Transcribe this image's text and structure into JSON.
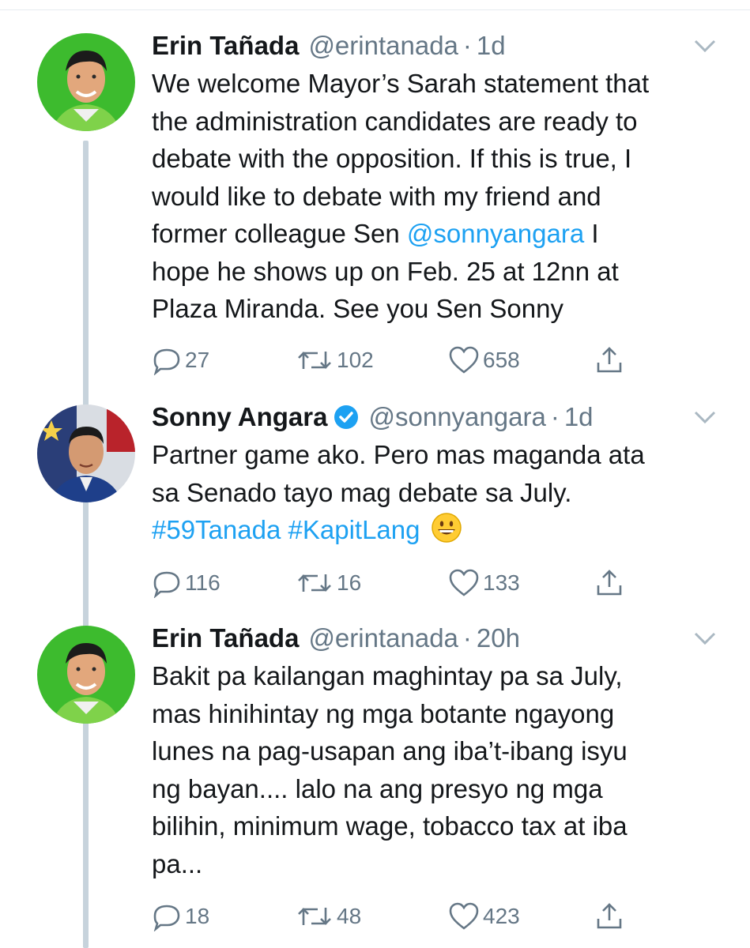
{
  "tweets": [
    {
      "name": "Erin Tañada",
      "handle": "@erintanada",
      "dot": "·",
      "time": "1d",
      "lines": [
        "We welcome Mayor’s Sarah statement that",
        "the administration candidates are ready to",
        "debate with the opposition. If this is true, I",
        "would like to debate with my friend and"
      ],
      "line5_text": "former colleague Sen ",
      "line5_link": "@sonnyangara",
      "line5_tail": " I",
      "line6": "hope he shows up on Feb. 25 at 12nn at",
      "line7": "Plaza Miranda. See you Sen Sonny",
      "replies": "27",
      "retweets": "102",
      "likes": "658"
    },
    {
      "name": "Sonny Angara",
      "handle": "@sonnyangara",
      "dot": "·",
      "time": "1d",
      "line1": "Partner game ako. Pero mas maganda ata",
      "line2": "sa Senado tayo mag debate sa July.",
      "hashtag1": "#59Tanada",
      "hashtag2": "#KapitLang",
      "emoji": "grinning-face-emoji",
      "replies": "116",
      "retweets": "16",
      "likes": "133"
    },
    {
      "name": "Erin Tañada",
      "handle": "@erintanada",
      "dot": "·",
      "time": "20h",
      "lines": [
        "Bakit pa kailangan maghintay pa sa July,",
        "mas hinihintay ng mga botante ngayong",
        "lunes na pag-usapan ang iba’t-ibang isyu",
        "ng bayan.... lalo na ang presyo ng mga",
        "bilihin, minimum wage, tobacco tax at iba",
        "pa..."
      ],
      "replies": "18",
      "retweets": "48",
      "likes": "423"
    }
  ],
  "icons": {
    "reply": "reply-icon",
    "retweet": "retweet-icon",
    "like": "like-icon",
    "share": "share-icon",
    "caret": "chevron-down-icon",
    "verified": "verified-badge-icon"
  },
  "colors": {
    "link": "#1da1f2",
    "meta": "#657786",
    "thread_line": "#c7d3dc",
    "avatar_green": "#3dbb2e"
  }
}
